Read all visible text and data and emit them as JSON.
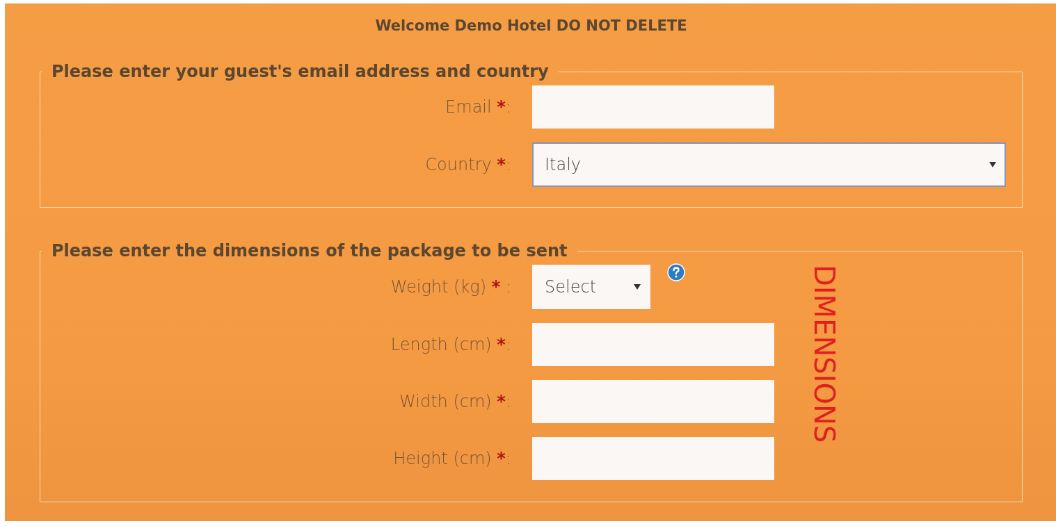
{
  "title": "Welcome Demo Hotel DO NOT DELETE",
  "sections": [
    {
      "legend": "Please enter your guest's email address and country",
      "fields": [
        {
          "kind": "text",
          "label": "Email",
          "mark": "*",
          "colon": ":"
        },
        {
          "kind": "select",
          "label": "Country",
          "mark": "*",
          "colon": ":",
          "value": "Italy",
          "focused": true
        }
      ]
    },
    {
      "legend": "Please enter the dimensions of the package to be sent",
      "side_label": "DIMENSIONS",
      "fields": [
        {
          "kind": "select-short",
          "label": "Weight (kg)",
          "mark": "*",
          "colon": " :",
          "value": "Select",
          "focused": false
        },
        {
          "kind": "text",
          "label": "Length (cm)",
          "mark": "*",
          "colon": ":"
        },
        {
          "kind": "text",
          "label": "Width (cm)",
          "mark": "*",
          "colon": ":"
        },
        {
          "kind": "text",
          "label": "Height (cm)",
          "mark": "*",
          "colon": ":"
        }
      ]
    }
  ]
}
